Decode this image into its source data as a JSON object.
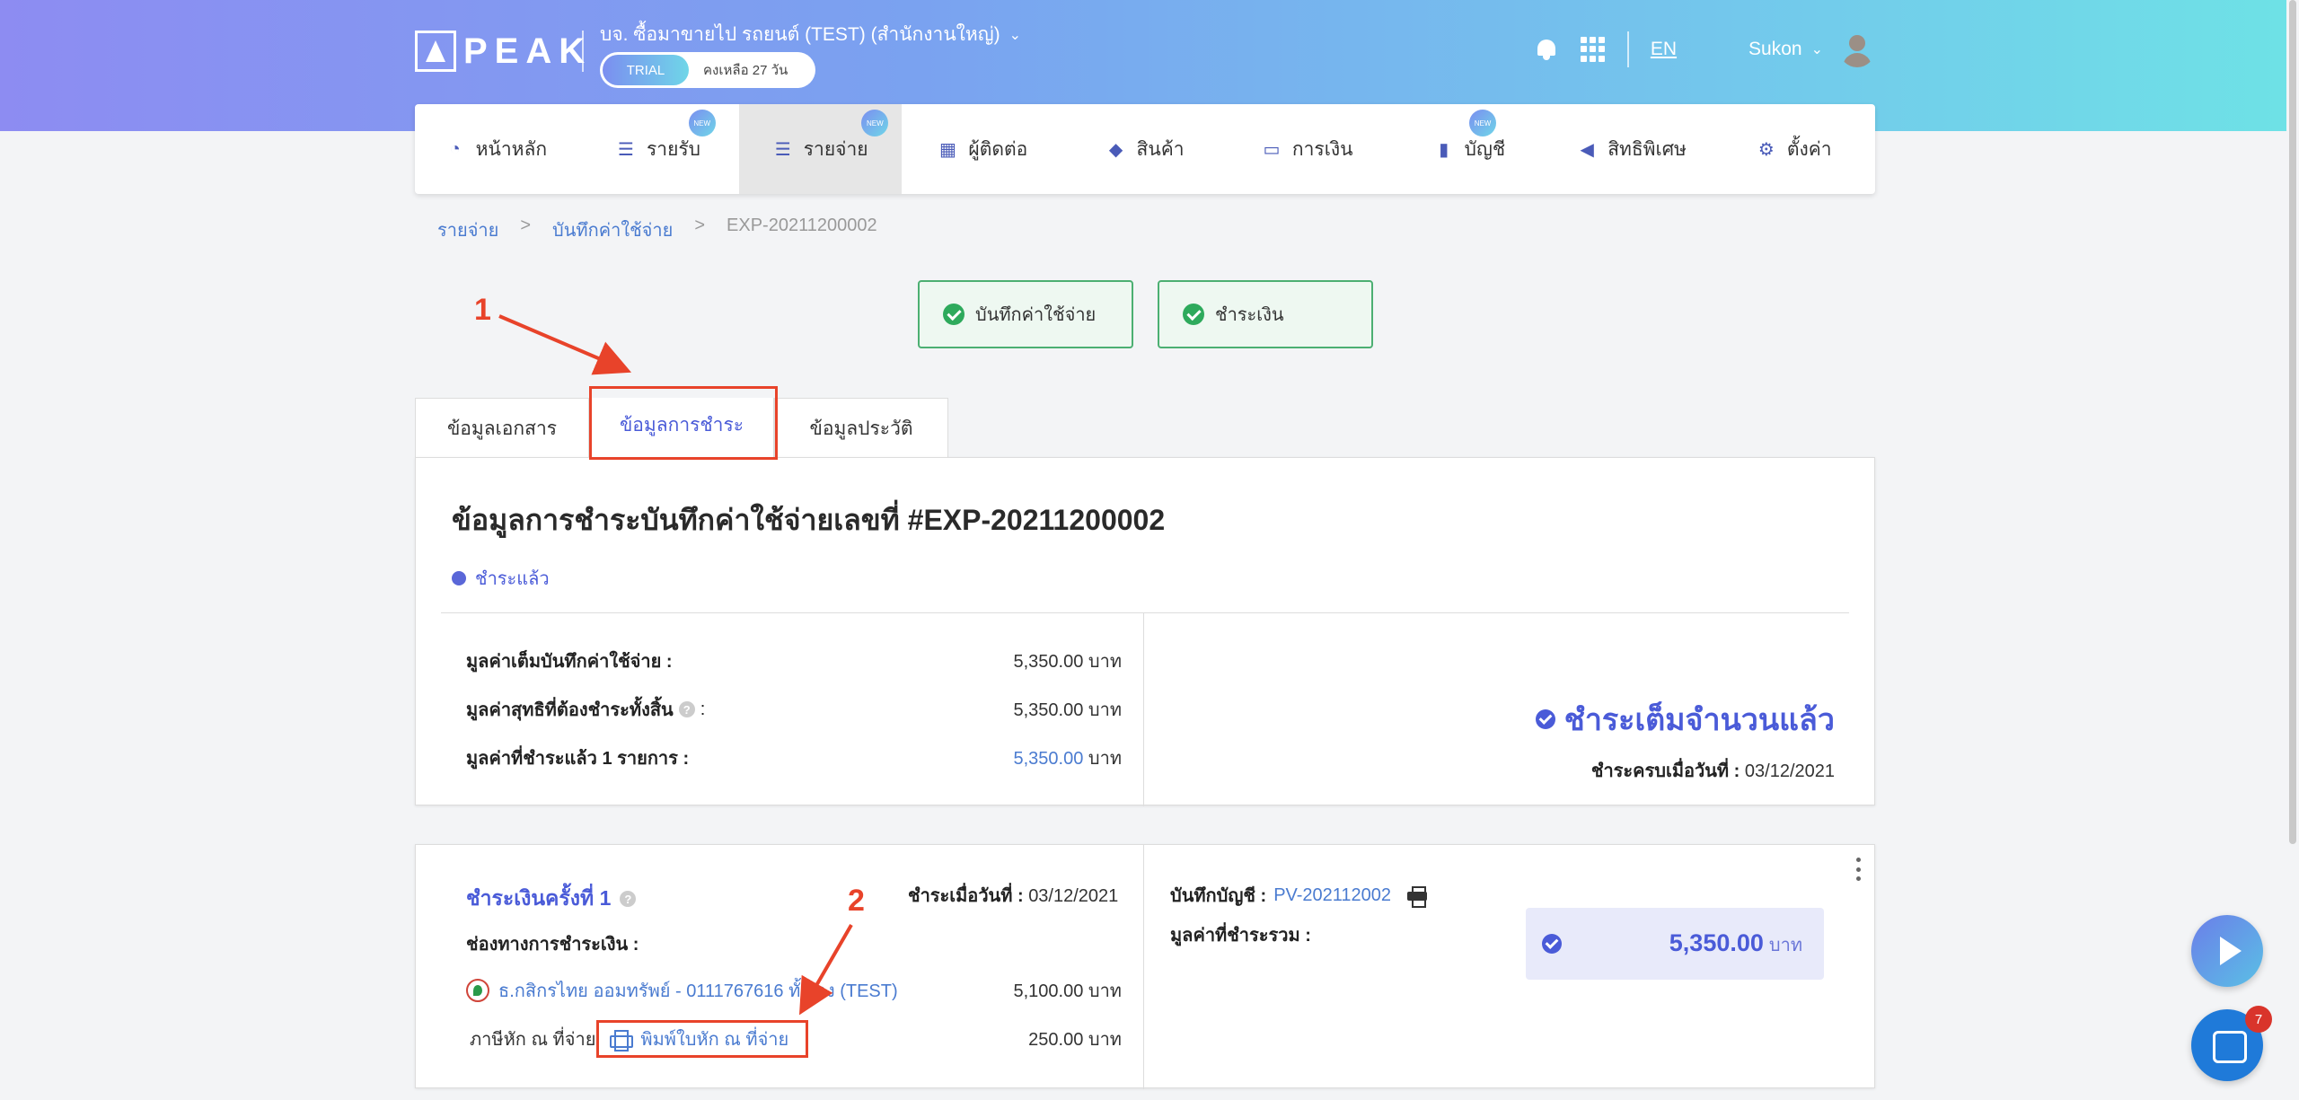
{
  "header": {
    "logo_text": "PEAK",
    "company_name": "บจ. ซื้อมาขายไป รถยนต์ (TEST) (สำนักงานใหญ่)",
    "trial_label": "TRIAL",
    "trial_remaining": "คงเหลือ 27 วัน",
    "language": "EN",
    "username": "Sukon"
  },
  "nav": {
    "items": [
      {
        "label": "หน้าหลัก",
        "icon": "dashboard-icon"
      },
      {
        "label": "รายรับ",
        "icon": "list-icon",
        "badge": "NEW"
      },
      {
        "label": "รายจ่าย",
        "icon": "list-icon",
        "badge": "NEW"
      },
      {
        "label": "ผู้ติดต่อ",
        "icon": "building-icon"
      },
      {
        "label": "สินค้า",
        "icon": "box-icon"
      },
      {
        "label": "การเงิน",
        "icon": "money-icon"
      },
      {
        "label": "บัญชี",
        "icon": "book-icon",
        "badge": "NEW"
      },
      {
        "label": "สิทธิพิเศษ",
        "icon": "megaphone-icon"
      },
      {
        "label": "ตั้งค่า",
        "icon": "gear-icon"
      }
    ]
  },
  "breadcrumb": {
    "items": [
      "รายจ่าย",
      "บันทึกค่าใช้จ่าย",
      "EXP-20211200002"
    ],
    "separator": ">"
  },
  "status_steps": [
    {
      "label": "บันทึกค่าใช้จ่าย"
    },
    {
      "label": "ชำระเงิน"
    }
  ],
  "annotations": {
    "one": "1",
    "two": "2"
  },
  "tabs": [
    {
      "label": "ข้อมูลเอกสาร"
    },
    {
      "label": "ข้อมูลการชำระ"
    },
    {
      "label": "ข้อมูลประวัติ"
    }
  ],
  "summary": {
    "title": "ข้อมูลการชำระบันทึกค่าใช้จ่ายเลขที่ #EXP-20211200002",
    "status": "ชำระแล้ว",
    "rows": [
      {
        "label": "มูลค่าเต็มบันทึกค่าใช้จ่าย :",
        "amount": "5,350.00",
        "unit": "บาท"
      },
      {
        "label": "มูลค่าสุทธิที่ต้องชำระทั้งสิ้น",
        "suffix": ":",
        "amount": "5,350.00",
        "unit": "บาท"
      },
      {
        "label": "มูลค่าที่ชำระแล้ว 1 รายการ :",
        "amount": "5,350.00",
        "unit": "บาท"
      }
    ],
    "full_paid": "ชำระเต็มจำนวนแล้ว",
    "paid_date_label": "ชำระครบเมื่อวันที่ :",
    "paid_date": "03/12/2021"
  },
  "payment": {
    "title": "ชำระเงินครั้งที่ 1",
    "date_label": "ชำระเมื่อวันที่ :",
    "date": "03/12/2021",
    "channel_label": "ช่องทางการชำระเงิน :",
    "bank": "ธ.กสิกรไทย ออมทรัพย์ - 0111767616 ทั้งเอง (TEST)",
    "bank_amount": "5,100.00 บาท",
    "wht_label": "ภาษีหัก ณ ที่จ่าย",
    "wht_link": "พิมพ์ใบหัก ณ ที่จ่าย",
    "wht_amount": "250.00 บาท",
    "account_label": "บันทึกบัญชี :",
    "account_no": "PV-202112002",
    "total_label": "มูลค่าที่ชำระรวม :",
    "total_amount": "5,350.00",
    "total_unit": "บาท"
  },
  "chat": {
    "badge_count": "7"
  },
  "colors": {
    "accent": "#4a5bd8",
    "link": "#4a7bd0",
    "annotation": "#e8432a",
    "success": "#2eaa5c"
  }
}
